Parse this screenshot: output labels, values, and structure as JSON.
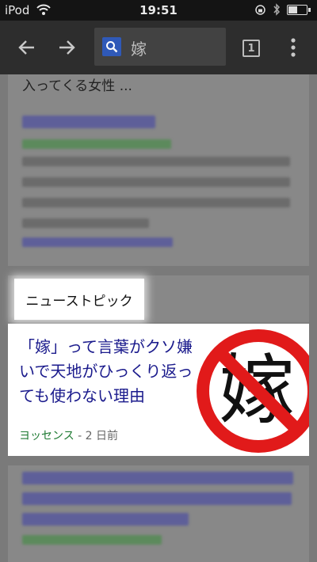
{
  "status_bar": {
    "carrier": "iPod",
    "time": "19:51",
    "battery_level": 0.5
  },
  "toolbar": {
    "search_query": "嫁",
    "tab_count": "1",
    "icons": [
      "back-arrow-icon",
      "forward-arrow-icon",
      "google-search-icon",
      "tabs-icon",
      "overflow-menu-icon"
    ]
  },
  "results": {
    "previous_snippet_tail": "入ってくる女性 ...",
    "news": {
      "section_label": "ニューストピック",
      "headline": "「嫁」って言葉がクソ嫌いで天地がひっくり返っても使わない理由",
      "source": "ヨッセンス",
      "age": " - 2 日前",
      "thumbnail_glyph": "嫁",
      "thumbnail_ring_color": "#e11a1a"
    }
  },
  "colors": {
    "toolbar_bg": "#2d2d2d",
    "headline_blue": "#1a1a8c",
    "source_green": "#1e7a32"
  }
}
